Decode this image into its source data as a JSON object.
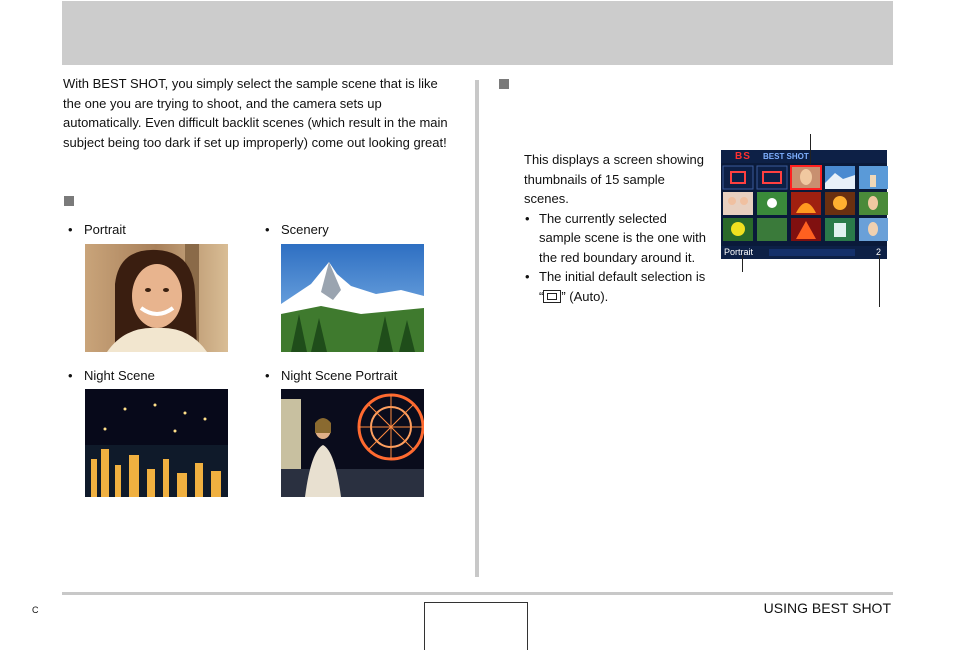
{
  "header": {
    "title": ""
  },
  "intro": {
    "paragraph": "With BEST SHOT, you simply select the sample scene that is like the one you are trying to shoot, and the camera sets up automatically. Even difficult backlit scenes (which result in the main subject being too dark if set up improperly) come out looking great!"
  },
  "scenes": {
    "heading": "",
    "items": [
      {
        "label": "Portrait"
      },
      {
        "label": "Scenery"
      },
      {
        "label": "Night Scene"
      },
      {
        "label": "Night Scene Portrait"
      }
    ]
  },
  "right": {
    "heading": "",
    "description": "This displays a screen showing thumbnails of 15 sample scenes.",
    "bullets": [
      "The currently selected sample scene is the one with the red boundary around it."
    ],
    "default_prefix": "The initial default selection is “",
    "default_suffix": "” (Auto).",
    "bullet_symbol": "•"
  },
  "lcd": {
    "bs_mark": "BS",
    "title": "BEST SHOT",
    "scene_name": "Portrait",
    "scene_number": "2",
    "colors": {
      "frame": "#0a1a3a",
      "selection": "#ff2020"
    }
  },
  "footer": {
    "left_mark": "C",
    "section": "USING BEST SHOT",
    "page_number": ""
  }
}
